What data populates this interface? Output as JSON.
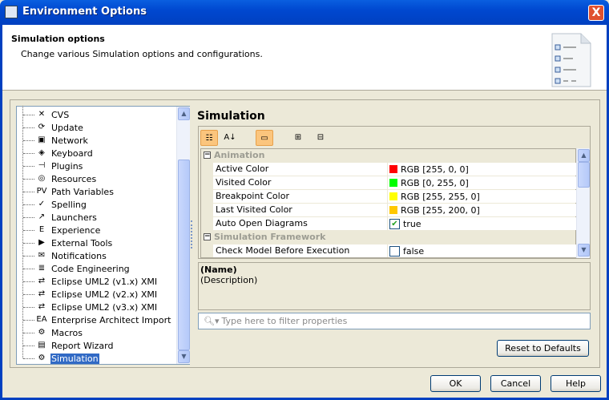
{
  "window": {
    "title": "Environment Options",
    "close_label": "X"
  },
  "header": {
    "title": "Simulation options",
    "description": "Change various Simulation options and configurations."
  },
  "tree": {
    "items": [
      {
        "label": "CVS",
        "icon": "cvs-icon",
        "glyph": "✕"
      },
      {
        "label": "Update",
        "icon": "update-icon",
        "glyph": "⟳"
      },
      {
        "label": "Network",
        "icon": "network-icon",
        "glyph": "▣"
      },
      {
        "label": "Keyboard",
        "icon": "keyboard-icon",
        "glyph": "◈"
      },
      {
        "label": "Plugins",
        "icon": "plugin-icon",
        "glyph": "⊣"
      },
      {
        "label": "Resources",
        "icon": "resources-icon",
        "glyph": "◎"
      },
      {
        "label": "Path Variables",
        "icon": "path-variables-icon",
        "glyph": "PV"
      },
      {
        "label": "Spelling",
        "icon": "spelling-icon",
        "glyph": "✓"
      },
      {
        "label": "Launchers",
        "icon": "launchers-icon",
        "glyph": "↗"
      },
      {
        "label": "Experience",
        "icon": "experience-icon",
        "glyph": "E"
      },
      {
        "label": "External Tools",
        "icon": "external-tools-icon",
        "glyph": "▶"
      },
      {
        "label": "Notifications",
        "icon": "envelope-icon",
        "glyph": "✉"
      },
      {
        "label": "Code Engineering",
        "icon": "code-engineering-icon",
        "glyph": "≣"
      },
      {
        "label": "Eclipse UML2 (v1.x) XMI",
        "icon": "exchange-arrows-icon",
        "glyph": "⇄"
      },
      {
        "label": "Eclipse UML2 (v2.x) XMI",
        "icon": "exchange-arrows-icon",
        "glyph": "⇄"
      },
      {
        "label": "Eclipse UML2 (v3.x) XMI",
        "icon": "exchange-arrows-icon",
        "glyph": "⇄"
      },
      {
        "label": "Enterprise Architect Import",
        "icon": "ea-import-icon",
        "glyph": "EA"
      },
      {
        "label": "Macros",
        "icon": "gear-icon",
        "glyph": "⚙"
      },
      {
        "label": "Report Wizard",
        "icon": "report-icon",
        "glyph": "▤"
      },
      {
        "label": "Simulation",
        "icon": "simulation-gear-icon",
        "glyph": "⚙",
        "selected": true
      }
    ]
  },
  "panel": {
    "title": "Simulation"
  },
  "grid": {
    "rows": [
      {
        "type": "category",
        "label": "Animation"
      },
      {
        "type": "color",
        "name": "Active Color",
        "value": "RGB [255, 0, 0]",
        "color": "#ff0000"
      },
      {
        "type": "color",
        "name": "Visited Color",
        "value": "RGB [0, 255, 0]",
        "color": "#00ff00"
      },
      {
        "type": "color",
        "name": "Breakpoint Color",
        "value": "RGB [255, 255, 0]",
        "color": "#ffff00"
      },
      {
        "type": "color",
        "name": "Last Visited Color",
        "value": "RGB [255, 200, 0]",
        "color": "#ffc800"
      },
      {
        "type": "bool",
        "name": "Auto Open Diagrams",
        "value": "true",
        "checked": true
      },
      {
        "type": "category",
        "label": "Simulation Framework"
      },
      {
        "type": "bool",
        "name": "Check Model Before Execution",
        "value": "false",
        "checked": false
      }
    ]
  },
  "description": {
    "name": "(Name)",
    "text": "(Description)"
  },
  "filter": {
    "placeholder": "Type here to filter properties"
  },
  "buttons": {
    "reset": "Reset to Defaults",
    "ok": "OK",
    "cancel": "Cancel",
    "help": "Help"
  }
}
